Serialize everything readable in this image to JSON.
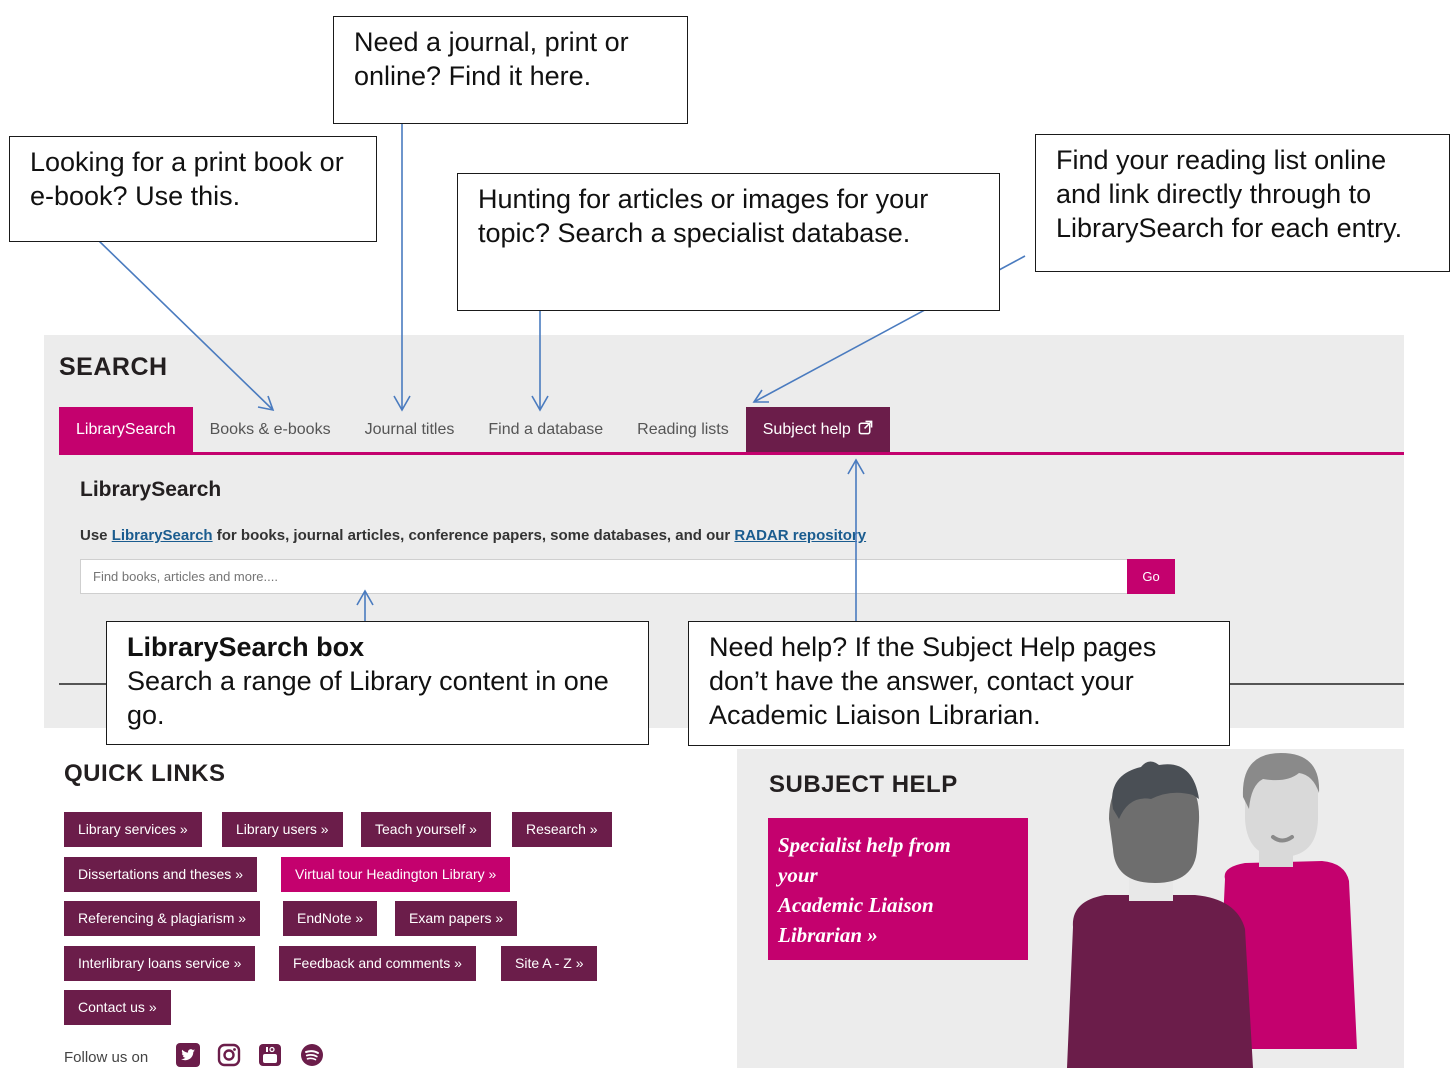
{
  "callouts": {
    "journal": "Need a journal, print or online? Find it here.",
    "books": "Looking for a print book or e-book? Use this.",
    "database": "Hunting for articles or images for your topic? Search a specialist database.",
    "reading": "Find your reading list online and link directly through to LibrarySearch for each entry.",
    "searchbox_title": "LibrarySearch box",
    "searchbox_body": "Search a range of Library content in one go.",
    "help": "Need help? If the Subject Help pages don’t have the answer, contact your Academic Liaison Librarian."
  },
  "search": {
    "heading": "SEARCH",
    "tabs": {
      "librarysearch": "LibrarySearch",
      "books": "Books & e-books",
      "journals": "Journal titles",
      "database": "Find a database",
      "reading": "Reading lists",
      "subject": "Subject help"
    },
    "panel_title": "LibrarySearch",
    "desc_prefix": "Use ",
    "desc_link1": "LibrarySearch",
    "desc_middle": " for books, journal articles, conference papers, some databases, and our ",
    "desc_link2": "RADAR repository",
    "placeholder": "Find books, articles and more....",
    "go_label": "Go"
  },
  "quick_links": {
    "heading": "QUICK LINKS",
    "library_services": "Library services »",
    "library_users": "Library users »",
    "teach_yourself": "Teach yourself »",
    "research": "Research »",
    "dissertations": "Dissertations and theses »",
    "virtual_tour": "Virtual tour Headington Library »",
    "referencing": "Referencing & plagiarism »",
    "endnote": "EndNote »",
    "exam_papers": "Exam papers »",
    "interlibrary": "Interlibrary loans service »",
    "feedback": "Feedback and comments »",
    "site_az": "Site A - Z »",
    "contact": "Contact us »",
    "follow": "Follow us on",
    "social_icons": [
      "twitter-icon",
      "instagram-icon",
      "youtube-icon",
      "spotify-icon"
    ]
  },
  "subject_help": {
    "heading": "SUBJECT HELP",
    "card_line1": "Specialist help from",
    "card_line2": "your",
    "card_line3": "Academic Liaison",
    "card_line4": "Librarian »"
  },
  "colors": {
    "brand_pink": "#c4016e",
    "brand_plum": "#6b1d4a",
    "panel_grey": "#ececec"
  }
}
